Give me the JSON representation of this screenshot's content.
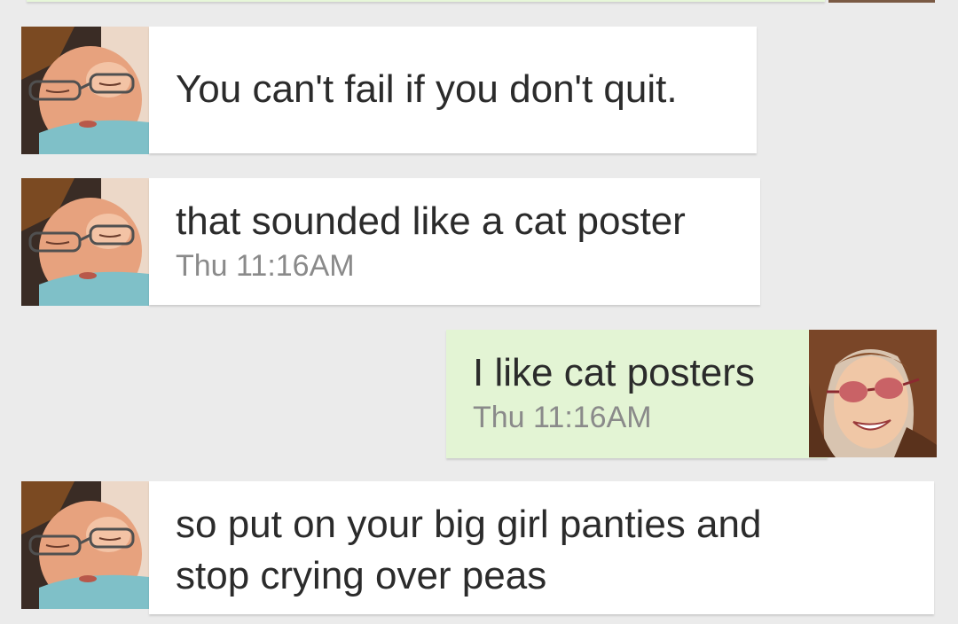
{
  "conversation": {
    "messages": [
      {
        "direction": "incoming",
        "text": "You can't fail if you don't quit.",
        "time": "",
        "avatar_icon": "baby-with-glasses-avatar"
      },
      {
        "direction": "incoming",
        "text": "that sounded like a cat poster",
        "time": "Thu 11:16AM",
        "avatar_icon": "baby-with-glasses-avatar"
      },
      {
        "direction": "outgoing",
        "text": "I like cat posters",
        "time": "Thu 11:16AM",
        "avatar_icon": "woman-with-sunglasses-avatar"
      },
      {
        "direction": "incoming",
        "text_line1": "so put on your big girl panties and",
        "text_line2": "stop crying over peas",
        "time": "",
        "avatar_icon": "baby-with-glasses-avatar"
      }
    ]
  },
  "colors": {
    "background": "#ebebeb",
    "incoming_bubble": "#ffffff",
    "outgoing_bubble": "#e3f4d4",
    "text": "#2b2b2b",
    "timestamp": "#8a8a8a"
  }
}
